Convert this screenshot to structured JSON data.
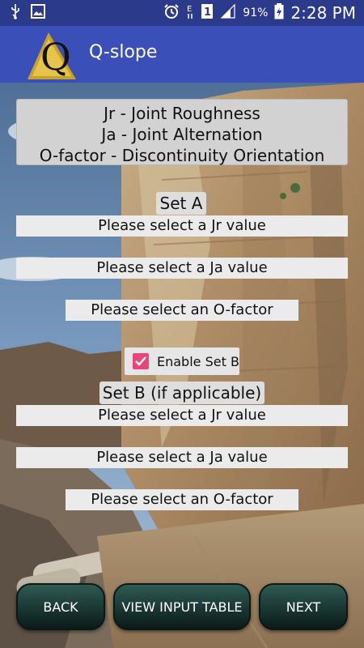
{
  "status_bar": {
    "battery_percent": "91%",
    "time": "2:28 PM",
    "icons": [
      "usb-icon",
      "image-icon",
      "alarm-icon",
      "data-e-icon",
      "sim-1-icon",
      "signal-icon",
      "battery-icon"
    ]
  },
  "app_bar": {
    "title": "Q-slope",
    "logo_letter": "Q"
  },
  "info": {
    "line1": "Jr - Joint Roughness",
    "line2": "Ja - Joint Alternation",
    "line3": "O-factor - Discontinuity Orientation"
  },
  "set_a": {
    "label": "Set A",
    "jr_select": "Please select a Jr value",
    "ja_select": "Please select a Ja value",
    "o_select": "Please select an O-factor"
  },
  "enable_set_b": {
    "label": "Enable Set B",
    "checked": true
  },
  "set_b": {
    "label": "Set B (if applicable)",
    "jr_select": "Please select a Jr value",
    "ja_select": "Please select a Ja value",
    "o_select": "Please select an O-factor"
  },
  "buttons": {
    "back": "BACK",
    "view_input_table": "VIEW INPUT TABLE",
    "next": "NEXT"
  },
  "colors": {
    "status_bar": "#2c3a8c",
    "app_bar": "#3a4fb8",
    "checkbox": "#e8457a",
    "button_top": "#2e5a52",
    "button_bottom": "#0b1a18"
  }
}
